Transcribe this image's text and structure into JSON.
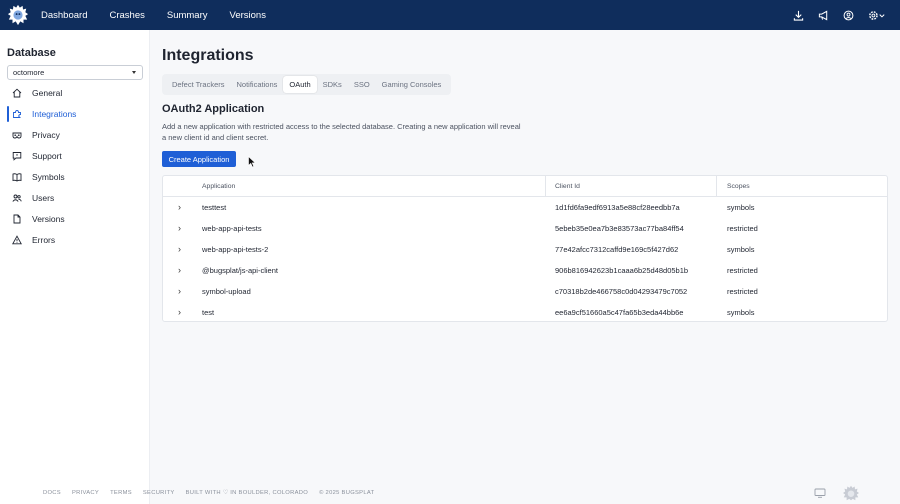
{
  "nav": {
    "items": [
      "Dashboard",
      "Crashes",
      "Summary",
      "Versions"
    ],
    "brand_color": "#0f2d5c",
    "right_icons": [
      "download-icon",
      "megaphone-icon",
      "user-circle-icon",
      "gear-icon"
    ]
  },
  "sidebar": {
    "title": "Database",
    "database_value": "octomore",
    "items": [
      {
        "label": "General",
        "icon": "home-icon"
      },
      {
        "label": "Integrations",
        "icon": "puzzle-icon"
      },
      {
        "label": "Privacy",
        "icon": "mask-icon"
      },
      {
        "label": "Support",
        "icon": "chat-icon"
      },
      {
        "label": "Symbols",
        "icon": "book-icon"
      },
      {
        "label": "Users",
        "icon": "users-icon"
      },
      {
        "label": "Versions",
        "icon": "file-icon"
      },
      {
        "label": "Errors",
        "icon": "warning-icon"
      }
    ],
    "active": "Integrations",
    "accent": "#1f5fd6"
  },
  "main": {
    "title": "Integrations",
    "tabs": [
      "Defect Trackers",
      "Notifications",
      "OAuth",
      "SDKs",
      "SSO",
      "Gaming Consoles"
    ],
    "active_tab": "OAuth",
    "section_title": "OAuth2 Application",
    "description": "Add a new application with restricted access to the selected database. Creating a new application will reveal a new client id and client secret.",
    "create_button": "Create Application"
  },
  "table": {
    "headers": [
      "Application",
      "Client Id",
      "Scopes"
    ],
    "rows": [
      {
        "application": "testtest",
        "client_id": "1d1fd6fa9edf6913a5e88cf28eedbb7a",
        "scopes": "symbols"
      },
      {
        "application": "web-app-api-tests",
        "client_id": "5ebeb35e0ea7b3e83573ac77ba84ff54",
        "scopes": "restricted"
      },
      {
        "application": "web-app-api-tests-2",
        "client_id": "77e42afcc7312caffd9e169c5f427d62",
        "scopes": "symbols"
      },
      {
        "application": "@bugsplat/js-api-client",
        "client_id": "906b816942623b1caaa6b25d48d05b1b",
        "scopes": "restricted"
      },
      {
        "application": "symbol-upload",
        "client_id": "c70318b2de466758c0d04293479c7052",
        "scopes": "restricted"
      },
      {
        "application": "test",
        "client_id": "ee6a9cf51660a5c47fa65b3eda44bb6e",
        "scopes": "symbols"
      }
    ]
  },
  "footer": {
    "links": [
      "DOCS",
      "PRIVACY",
      "TERMS",
      "SECURITY"
    ],
    "built_with": "BUILT WITH ♡ IN BOULDER, COLORADO",
    "copyright": "© 2025 BUGSPLAT"
  }
}
